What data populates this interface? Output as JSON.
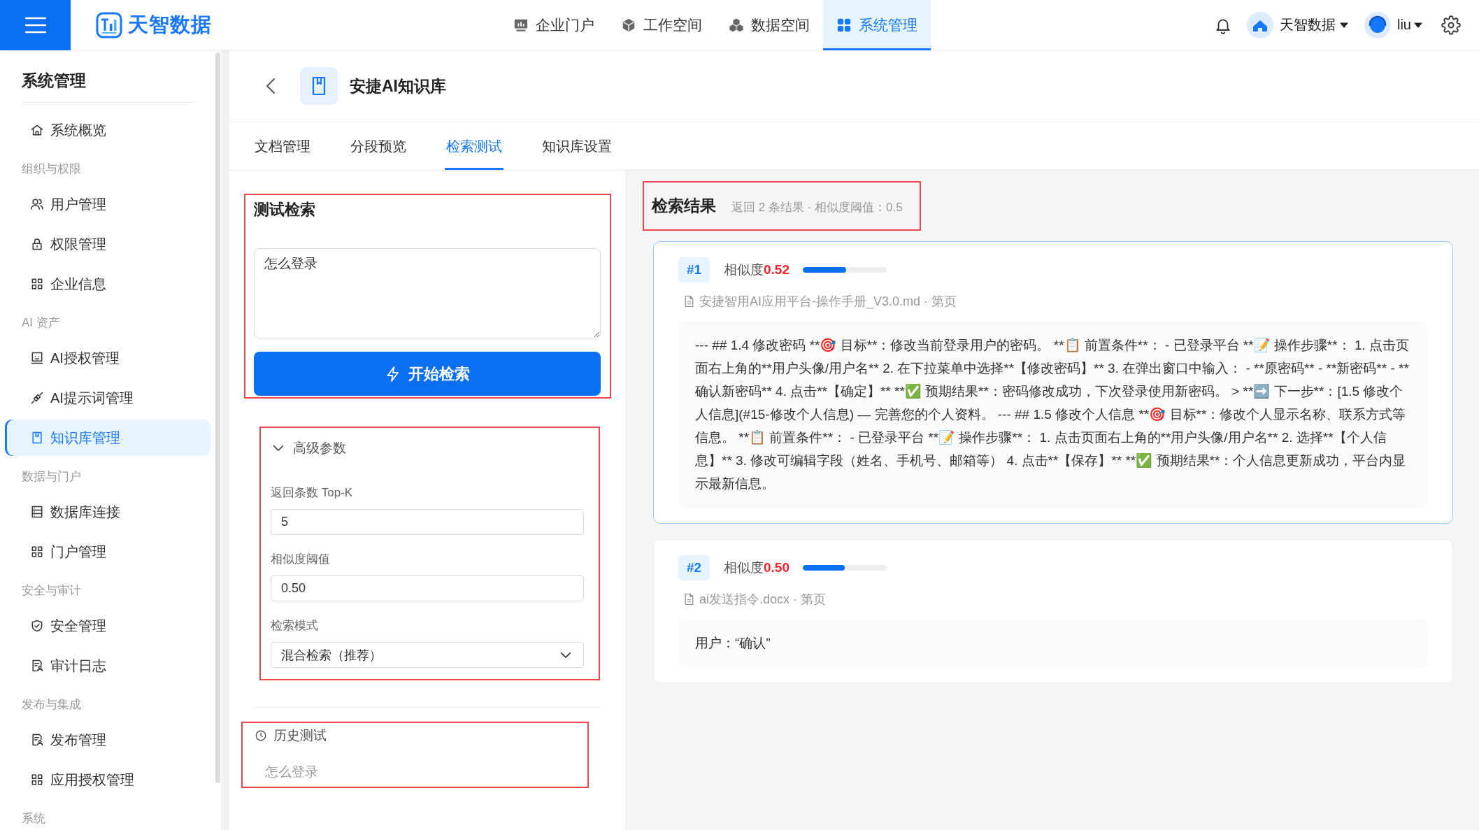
{
  "top_bar": {
    "logo_text": "天智数据",
    "nav": [
      {
        "label": "企业门户",
        "selected": false
      },
      {
        "label": "工作空间",
        "selected": false
      },
      {
        "label": "数据空间",
        "selected": false
      },
      {
        "label": "系统管理",
        "selected": true
      }
    ],
    "org": "天智数据",
    "user": "liu"
  },
  "sidebar": {
    "title": "系统管理",
    "sections": [
      {
        "items": [
          {
            "label": "系统概览",
            "selected": false
          }
        ]
      },
      {
        "heading": "组织与权限",
        "items": [
          {
            "label": "用户管理",
            "selected": false
          },
          {
            "label": "权限管理",
            "selected": false
          },
          {
            "label": "企业信息",
            "selected": false
          }
        ]
      },
      {
        "heading": "AI 资产",
        "items": [
          {
            "label": "AI授权管理",
            "selected": false
          },
          {
            "label": "AI提示词管理",
            "selected": false
          },
          {
            "label": "知识库管理",
            "selected": true
          }
        ]
      },
      {
        "heading": "数据与门户",
        "items": [
          {
            "label": "数据库连接",
            "selected": false
          },
          {
            "label": "门户管理",
            "selected": false
          }
        ]
      },
      {
        "heading": "安全与审计",
        "items": [
          {
            "label": "安全管理",
            "selected": false
          },
          {
            "label": "审计日志",
            "selected": false
          }
        ]
      },
      {
        "heading": "发布与集成",
        "items": [
          {
            "label": "发布管理",
            "selected": false
          },
          {
            "label": "应用授权管理",
            "selected": false
          }
        ]
      },
      {
        "heading": "系统"
      }
    ]
  },
  "page_header": {
    "title": "安捷AI知识库"
  },
  "tabs": [
    {
      "label": "文档管理",
      "selected": false
    },
    {
      "label": "分段预览",
      "selected": false
    },
    {
      "label": "检索测试",
      "selected": true
    },
    {
      "label": "知识库设置",
      "selected": false
    }
  ],
  "test_panel": {
    "annotated": true,
    "title": "测试检索",
    "query": "怎么登录",
    "button": "开始检索"
  },
  "advanced": {
    "annotated": true,
    "title": "高级参数",
    "expanded": true,
    "fields": [
      {
        "kind": "input",
        "label": "返回条数 Top-K",
        "value": "5"
      },
      {
        "kind": "input",
        "label": "相似度阈值",
        "value": "0.50"
      },
      {
        "kind": "select",
        "label": "检索模式",
        "value": "混合检索（推荐）"
      }
    ]
  },
  "history": {
    "annotated": true,
    "title": "历史测试",
    "items": [
      "怎么登录"
    ]
  },
  "results": {
    "annotated": true,
    "title": "检索结果",
    "summary": "返回 2 条结果 · 相似度阈值：0.5",
    "items": [
      {
        "rank": "#1",
        "similarity_label": "相似度",
        "score": "0.52",
        "level": 0.52,
        "selected": true,
        "source": "安捷智用AI应用平台-操作手册_V3.0.md · 第页",
        "content": "--- ## 1.4 修改密码 **🎯 目标**：修改当前登录用户的密码。 **📋 前置条件**： - 已登录平台 **📝 操作步骤**： 1. 点击页面右上角的**用户头像/用户名** 2. 在下拉菜单中选择**【修改密码】** 3. 在弹出窗口中输入： - **原密码** - **新密码** - **确认新密码** 4. 点击**【确定】** **✅ 预期结果**：密码修改成功，下次登录使用新密码。 > **➡️ 下一步**：[1.5 修改个人信息](#15-修改个人信息) — 完善您的个人资料。 --- ## 1.5 修改个人信息 **🎯 目标**：修改个人显示名称、联系方式等信息。 **📋 前置条件**： - 已登录平台 **📝 操作步骤**： 1. 点击页面右上角的**用户头像/用户名** 2. 选择**【个人信息】** 3. 修改可编辑字段（姓名、手机号、邮箱等） 4. 点击**【保存】** **✅ 预期结果**：个人信息更新成功，平台内显示最新信息。"
      },
      {
        "rank": "#2",
        "similarity_label": "相似度",
        "score": "0.50",
        "level": 0.5,
        "selected": false,
        "source": "ai发送指令.docx · 第页",
        "content": "用户：“确认”"
      }
    ]
  }
}
